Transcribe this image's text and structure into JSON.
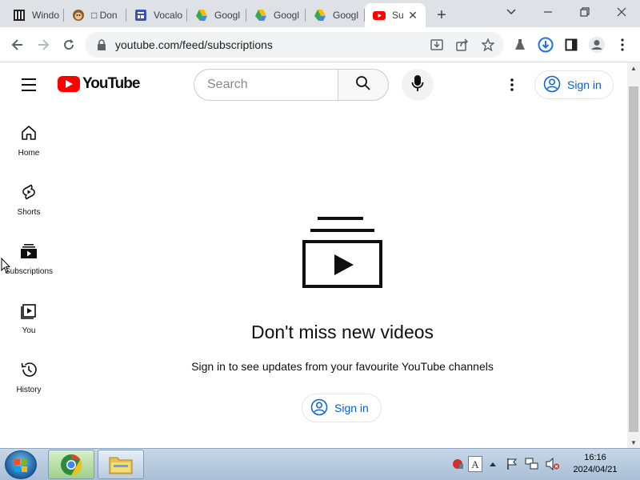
{
  "browser": {
    "tabs": [
      {
        "title": "Windo",
        "favicon": "windows-icon",
        "active": false
      },
      {
        "title": "□ Don",
        "favicon": "monkey-icon",
        "active": false
      },
      {
        "title": "Vocalo",
        "favicon": "form-icon",
        "active": false
      },
      {
        "title": "Googl",
        "favicon": "google-drive-icon",
        "active": false
      },
      {
        "title": "Googl",
        "favicon": "google-drive-icon",
        "active": false
      },
      {
        "title": "Googl",
        "favicon": "google-drive-icon",
        "active": false
      },
      {
        "title": "Su",
        "favicon": "youtube-icon",
        "active": true
      }
    ],
    "url": "youtube.com/feed/subscriptions"
  },
  "youtube": {
    "logo_text": "YouTube",
    "search_placeholder": "Search",
    "sign_in_label": "Sign in",
    "guide": [
      {
        "label": "Home",
        "icon": "home-icon"
      },
      {
        "label": "Shorts",
        "icon": "shorts-icon"
      },
      {
        "label": "Subscriptions",
        "icon": "subscriptions-icon"
      },
      {
        "label": "You",
        "icon": "you-icon"
      },
      {
        "label": "History",
        "icon": "history-icon"
      }
    ],
    "empty_state": {
      "title": "Don't miss new videos",
      "subtitle": "Sign in to see updates from your favourite YouTube channels",
      "button": "Sign in"
    }
  },
  "taskbar": {
    "time": "16:16",
    "date": "2024/04/21"
  },
  "colors": {
    "youtube_red": "#ff0000",
    "link_blue": "#065fd4",
    "tab_strip": "#dee1e6"
  }
}
